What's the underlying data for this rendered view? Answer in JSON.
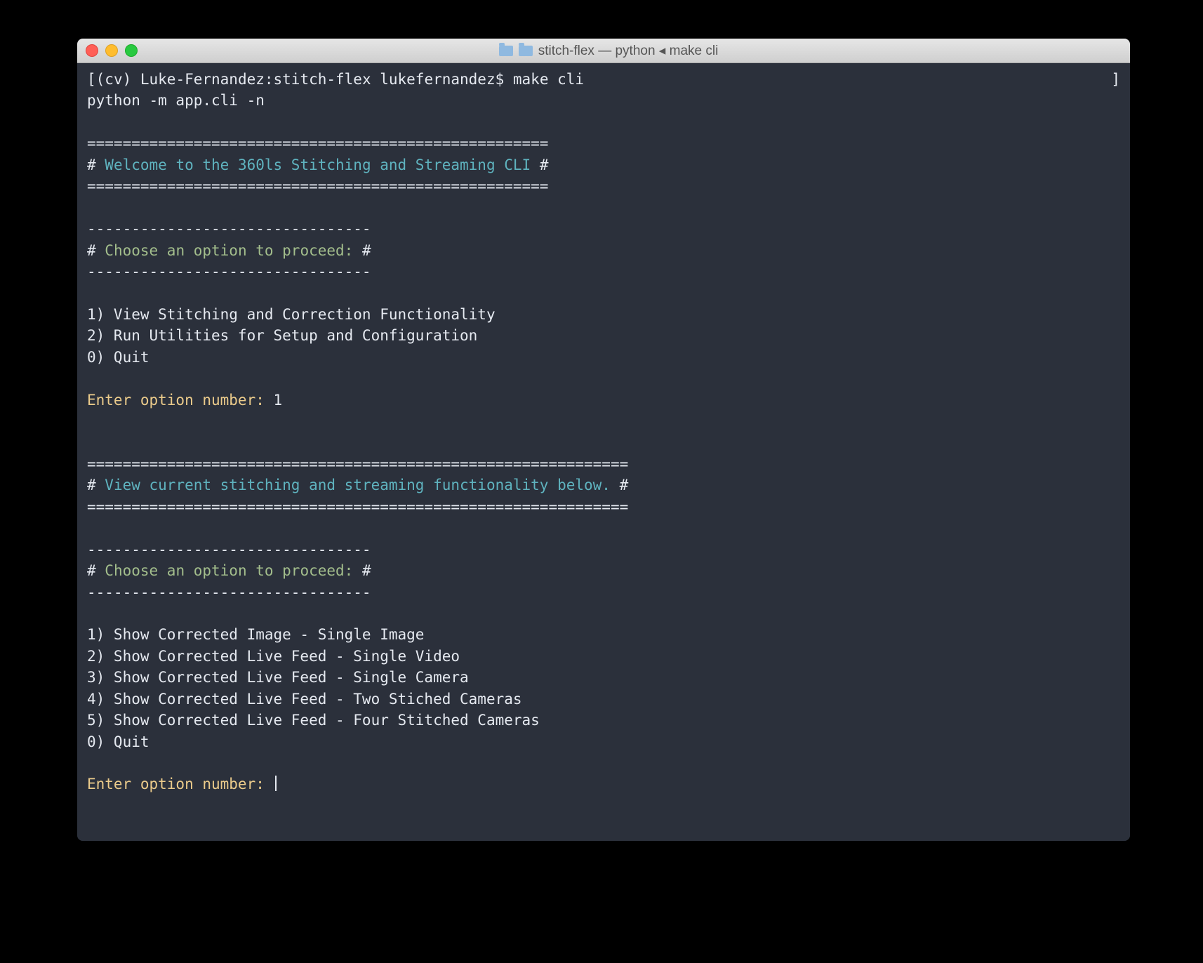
{
  "titlebar": {
    "title": "stitch-flex — python ◂ make cli"
  },
  "prompt": {
    "left_bracket": "[",
    "env": "(cv) ",
    "hostpath": "Luke-Fernandez:stitch-flex lukefernandez$",
    "command": " make cli",
    "right_bracket": "]"
  },
  "run_line": "python -m app.cli -n",
  "banner1": {
    "rule": "====================================================",
    "hash": "# ",
    "text": "Welcome to the 360ls Stitching and Streaming CLI",
    "hash_end": " #"
  },
  "choose1": {
    "rule": "--------------------------------",
    "hash": "# ",
    "text": "Choose an option to proceed:",
    "hash_end": " #"
  },
  "menu1": {
    "o1": "1) View Stitching and Correction Functionality",
    "o2": "2) Run Utilities for Setup and Configuration",
    "o0": "0) Quit"
  },
  "enter1": {
    "label": "Enter option number: ",
    "value": "1"
  },
  "banner2": {
    "rule": "=============================================================",
    "hash": "# ",
    "text": "View current stitching and streaming functionality below.",
    "hash_end": " #"
  },
  "choose2": {
    "rule": "--------------------------------",
    "hash": "# ",
    "text": "Choose an option to proceed:",
    "hash_end": " #"
  },
  "menu2": {
    "o1": "1) Show Corrected Image - Single Image",
    "o2": "2) Show Corrected Live Feed - Single Video",
    "o3": "3) Show Corrected Live Feed - Single Camera",
    "o4": "4) Show Corrected Live Feed - Two Stiched Cameras",
    "o5": "5) Show Corrected Live Feed - Four Stitched Cameras",
    "o0": "0) Quit"
  },
  "enter2": {
    "label": "Enter option number: "
  }
}
